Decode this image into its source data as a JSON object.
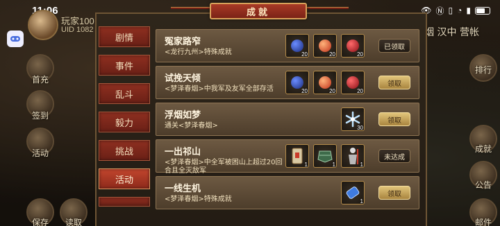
{
  "status_bar": {
    "time": "11:06",
    "battery": ""
  },
  "player": {
    "name": "玩家100",
    "uid": "UID 1082"
  },
  "side_left": [
    "首充",
    "签到",
    "活动",
    "保存",
    "读取"
  ],
  "side_right": [
    "排行",
    "成就",
    "公告",
    "邮件"
  ],
  "top_right_text": "烟 汉中  营帐",
  "dialog": {
    "title": "成就",
    "tabs": [
      "剧情",
      "事件",
      "乱斗",
      "毅力",
      "挑战",
      "活动"
    ],
    "active_tab_index": 5,
    "achievements": [
      {
        "title": "冤家路窄",
        "desc": "<龙行九州>特殊成就",
        "rewards": [
          {
            "icon": "blueberry-icon",
            "count": "20"
          },
          {
            "icon": "peach-icon",
            "count": "20"
          },
          {
            "icon": "red-gem-icon",
            "count": "20"
          }
        ],
        "button": "已领取",
        "button_style": "dark"
      },
      {
        "title": "试挽天倾",
        "desc": "<梦泽春烟>中我军及友军全部存活",
        "rewards": [
          {
            "icon": "blueberry-icon",
            "count": "20"
          },
          {
            "icon": "peach-icon",
            "count": "20"
          },
          {
            "icon": "red-gem-icon",
            "count": "20"
          }
        ],
        "button": "领取",
        "button_style": "gold"
      },
      {
        "title": "浮烟如梦",
        "desc": "通关<梦泽春烟>",
        "rewards": [
          {
            "icon": "snowflake-icon",
            "count": "30"
          }
        ],
        "button": "领取",
        "button_style": "gold"
      },
      {
        "title": "一出祁山",
        "desc": "<梦泽春烟>中全军被困山上超过20回合且全灭敌军",
        "rewards": [
          {
            "icon": "scroll-icon",
            "count": "1"
          },
          {
            "icon": "armor-icon",
            "count": "1"
          },
          {
            "icon": "warrior-icon",
            "count": "1"
          }
        ],
        "button": "未达成",
        "button_style": "dark"
      },
      {
        "title": "一线生机",
        "desc": "<梦泽春烟>特殊成就",
        "rewards": [
          {
            "icon": "blue-potion-icon",
            "count": "1"
          }
        ],
        "button": "领取",
        "button_style": "gold"
      }
    ]
  },
  "colors": {
    "tab_red": "#8e2f20",
    "gold_button": "#e1c47a",
    "card_bg": "#6d5942"
  }
}
